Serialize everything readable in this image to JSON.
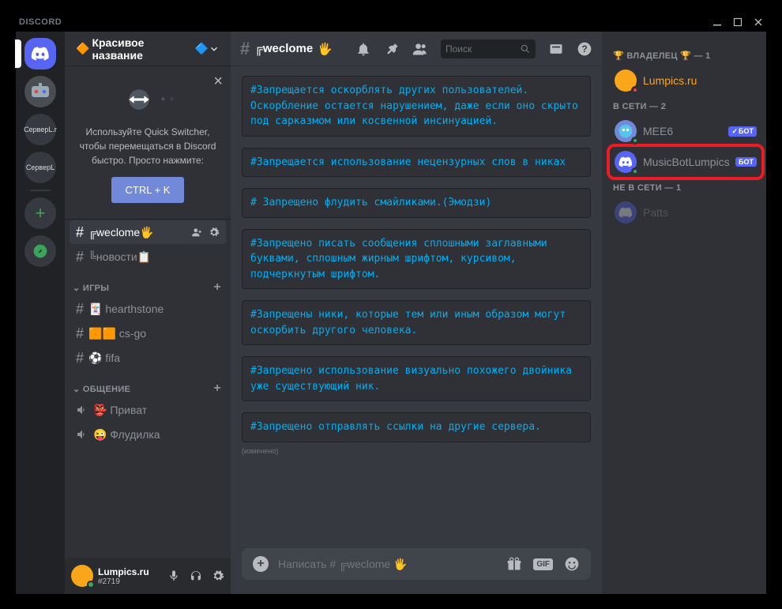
{
  "app_title": "DISCORD",
  "server": {
    "name": "Красивое название",
    "dropdown": "∨"
  },
  "quick_switcher": {
    "text": "Используйте Quick Switcher, чтобы перемещаться в Discord быстро. Просто нажмите:",
    "button": "CTRL + K"
  },
  "channels": {
    "top": [
      {
        "name": "╔weclome",
        "emoji": "🖐",
        "active": true
      },
      {
        "name": "╚новости",
        "emoji": "📋"
      }
    ],
    "categories": [
      {
        "name": "ИГРЫ",
        "items": [
          {
            "name": "hearthstone",
            "prefix": "🃏",
            "type": "text"
          },
          {
            "name": "cs-go",
            "prefix": "🟧🟧",
            "type": "text"
          },
          {
            "name": "fifa",
            "prefix": "⚽",
            "type": "text"
          }
        ]
      },
      {
        "name": "ОБЩЕНИЕ",
        "items": [
          {
            "name": "Приват",
            "prefix": "👺",
            "type": "voice"
          },
          {
            "name": "Флудилка",
            "prefix": "😜",
            "type": "voice"
          }
        ]
      }
    ]
  },
  "user": {
    "name": "Lumpics.ru",
    "discriminator": "#2719"
  },
  "channel_header": {
    "hash": "#",
    "name": "╔weclome",
    "emoji": "🖐"
  },
  "search": {
    "placeholder": "Поиск"
  },
  "messages": [
    "#Запрещается оскорблять других пользователей. Оскорбление остается нарушением, даже если оно скрыто под сарказмом или косвенной инсинуацией.",
    "#Запрещается использование нецензурных слов в никах",
    "# Запрещено флудить смайликами.(Эмодзи)",
    "#Запрещено писать сообщения сплошными заглавными буквами, сплошным жирным шрифтом, курсивом, подчеркнутым шрифтом.",
    "#Запрещены ники, которые тем или иным образом могут оскорбить другого человека.",
    "#Запрещено использование визуально похожего двойника уже существующий ник.",
    "#Запрещено отправлять ссылки на другие сервера."
  ],
  "edited_label": "(изменено)",
  "input": {
    "placeholder": "Написать # ╔weclome 🖐",
    "gif": "GIF"
  },
  "members": {
    "owner": {
      "label": "🏆 ВЛАДЕЛЕЦ 🏆 — 1",
      "items": [
        {
          "name": "Lumpics.ru",
          "color": "#faa61a"
        }
      ]
    },
    "online": {
      "label": "В СЕТИ — 2",
      "items": [
        {
          "name": "MEE6",
          "bot": true,
          "verified": true
        },
        {
          "name": "MusicBotLumpics",
          "bot": true,
          "verified": false,
          "highlight": true
        }
      ]
    },
    "offline": {
      "label": "НЕ В СЕТИ — 1",
      "items": [
        {
          "name": "Patts"
        }
      ]
    },
    "bot_label": "БОТ"
  },
  "guilds": {
    "label1": "СерверL.r",
    "label2": "СерверL"
  }
}
